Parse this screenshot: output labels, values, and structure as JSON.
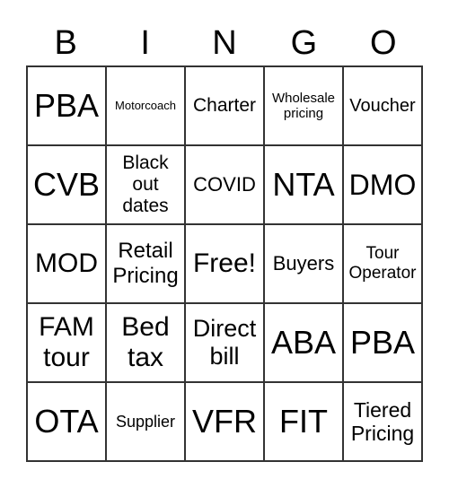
{
  "header": [
    "B",
    "I",
    "N",
    "G",
    "O"
  ],
  "cells": [
    "PBA",
    "Motorcoach",
    "Charter",
    "Wholesale pricing",
    "Voucher",
    "CVB",
    "Black out dates",
    "COVID",
    "NTA",
    "DMO",
    "MOD",
    "Retail Pricing",
    "Free!",
    "Buyers",
    "Tour Operator",
    "FAM tour",
    "Bed tax",
    "Direct bill",
    "ABA",
    "PBA",
    "OTA",
    "Supplier",
    "VFR",
    "FIT",
    "Tiered Pricing"
  ]
}
